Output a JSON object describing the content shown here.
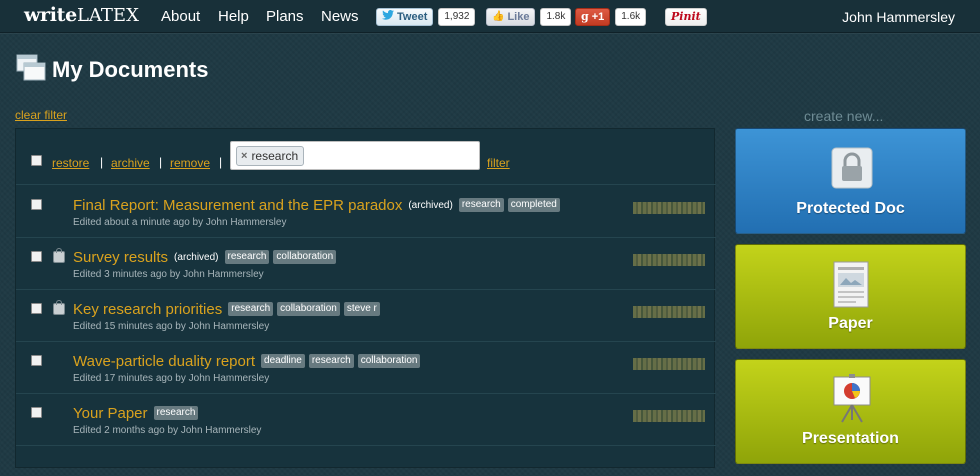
{
  "nav": {
    "logo_main": "write",
    "logo_latex": "LATEX",
    "links": [
      "About",
      "Help",
      "Plans",
      "News"
    ],
    "user": "John Hammersley"
  },
  "social": {
    "tweet_label": "Tweet",
    "tweet_count": "1,932",
    "like_label": "Like",
    "like_count": "1.8k",
    "gplus_label": "+1",
    "gplus_count": "1.6k",
    "pin_label": "Pinit"
  },
  "header": {
    "title": "My Documents",
    "clear_filter": "clear filter",
    "create_new": "create new..."
  },
  "toolbar": {
    "restore": "restore",
    "archive": "archive",
    "remove": "remove",
    "filter_chip": "research",
    "filter_button": "filter"
  },
  "documents": [
    {
      "title": "Final Report: Measurement and the EPR paradox",
      "archived": "(archived)",
      "tags": [
        "research",
        "completed"
      ],
      "meta": "Edited about a minute ago by John Hammersley",
      "locked": false
    },
    {
      "title": "Survey results",
      "archived": "(archived)",
      "tags": [
        "research",
        "collaboration"
      ],
      "meta": "Edited 3 minutes ago by John Hammersley",
      "locked": true
    },
    {
      "title": "Key research priorities",
      "archived": "",
      "tags": [
        "research",
        "collaboration",
        "steve r"
      ],
      "meta": "Edited 15 minutes ago by John Hammersley",
      "locked": true
    },
    {
      "title": "Wave-particle duality report",
      "archived": "",
      "tags": [
        "deadline",
        "research",
        "collaboration"
      ],
      "meta": "Edited 17 minutes ago by John Hammersley",
      "locked": false
    },
    {
      "title": "Your Paper",
      "archived": "",
      "tags": [
        "research"
      ],
      "meta": "Edited 2 months ago by John Hammersley",
      "locked": false
    }
  ],
  "create": {
    "protected_doc": "Protected Doc",
    "paper": "Paper",
    "presentation": "Presentation"
  },
  "colors": {
    "background": "#1f3a44",
    "link": "#d9a21e",
    "tile_blue": "#2f82c6",
    "tile_green": "#aabd12"
  }
}
